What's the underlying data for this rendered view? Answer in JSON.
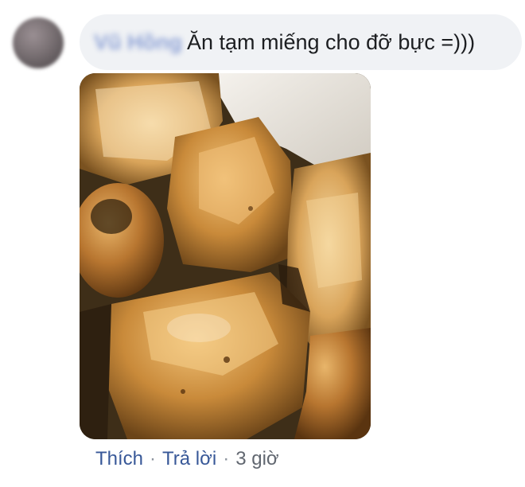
{
  "comment": {
    "author_name": "Vũ Hồng",
    "text": "Ăn tạm miếng cho đỡ bực =)))"
  },
  "actions": {
    "like_label": "Thích",
    "separator": "·",
    "reply_label": "Trả lời",
    "timestamp": "3 giờ"
  },
  "colors": {
    "bubble_bg": "#f0f2f5",
    "link": "#385898",
    "meta_text": "#616770"
  }
}
